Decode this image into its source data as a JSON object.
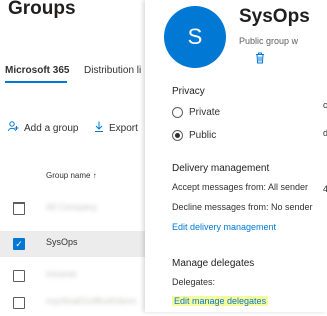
{
  "page": {
    "title": "Groups"
  },
  "tabs": [
    {
      "label": "Microsoft 365"
    },
    {
      "label": "Distribution li"
    }
  ],
  "commands": {
    "add_group": "Add a group",
    "export": "Export",
    "add_icon": "person-add-icon",
    "export_icon": "download-icon"
  },
  "table": {
    "column_header": "Group name ↑",
    "rows": [
      {
        "name": "All Company",
        "selected": false,
        "blurred": true
      },
      {
        "name": "SysOps",
        "selected": true,
        "blurred": false
      },
      {
        "name": "Intranet",
        "selected": false,
        "blurred": true
      },
      {
        "name": "mycfinal01officeKiterm",
        "selected": false,
        "blurred": true
      }
    ]
  },
  "panel": {
    "avatar_initial": "S",
    "name": "SysOps",
    "subtitle": "Public group w",
    "delete_icon": "trash-icon",
    "privacy": {
      "heading": "Privacy",
      "options": [
        {
          "label": "Private",
          "checked": false
        },
        {
          "label": "Public",
          "checked": true
        }
      ]
    },
    "delivery": {
      "heading": "Delivery management",
      "accept": "Accept messages from: All sender",
      "decline": "Decline messages from: No sender",
      "edit_link": "Edit delivery management"
    },
    "delegates": {
      "heading": "Manage delegates",
      "label": "Delegates:",
      "edit_link": "Edit manage delegates"
    },
    "edge_fragments": [
      "c",
      "d",
      "4"
    ]
  },
  "colors": {
    "accent": "#0078d4",
    "highlight": "#fafa9a"
  }
}
